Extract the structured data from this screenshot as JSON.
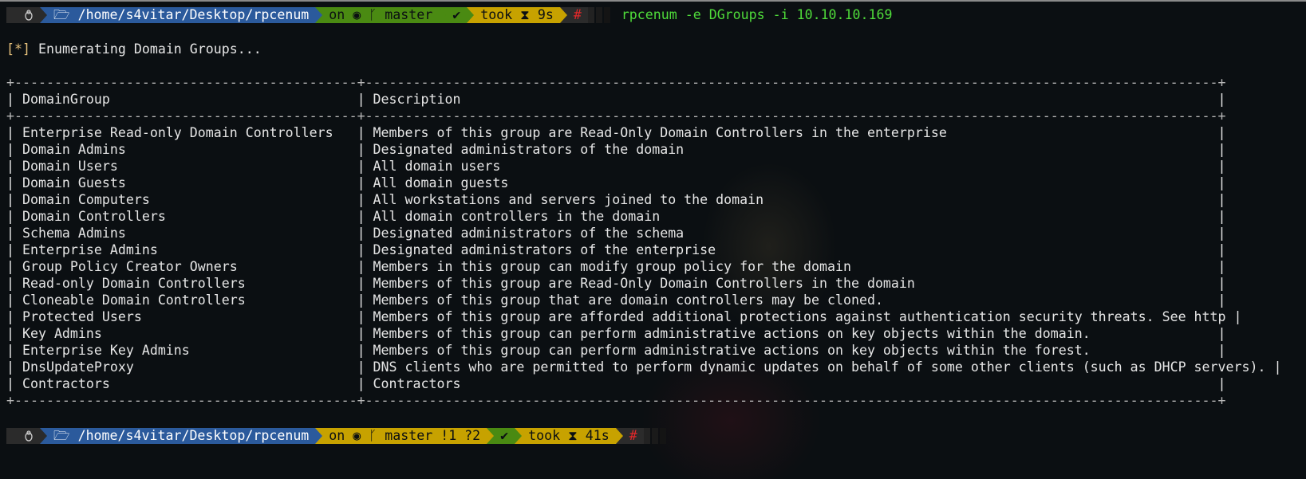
{
  "prompt1": {
    "os_icon": "linux-tux-icon",
    "folder_icon": "folder-icon",
    "path": "/home/s4vitar/Desktop/rpcenum",
    "git_on": "on",
    "git_icon": "github-octocat-icon",
    "branch_icon": "git-branch-icon",
    "branch": "master",
    "status_icon": "✔",
    "took": "took",
    "hourglass": "⧗",
    "duration": "9s",
    "hash": "#",
    "command": "rpcenum -e DGroups -i 10.10.10.169"
  },
  "output": {
    "message_prefix": "[*]",
    "message": " Enumerating Domain Groups..."
  },
  "table": {
    "border_top": "+-------------------------------------------+-----------------------------------------------------------------------------------------------------------+",
    "header_row": "| DomainGroup                               | Description                                                                                               |",
    "border_mid": "+-------------------------------------------+-----------------------------------------------------------------------------------------------------------+",
    "rows": [
      "| Enterprise Read-only Domain Controllers   | Members of this group are Read-Only Domain Controllers in the enterprise                                  |",
      "| Domain Admins                             | Designated administrators of the domain                                                                   |",
      "| Domain Users                              | All domain users                                                                                          |",
      "| Domain Guests                             | All domain guests                                                                                         |",
      "| Domain Computers                          | All workstations and servers joined to the domain                                                         |",
      "| Domain Controllers                        | All domain controllers in the domain                                                                      |",
      "| Schema Admins                             | Designated administrators of the schema                                                                   |",
      "| Enterprise Admins                         | Designated administrators of the enterprise                                                               |",
      "| Group Policy Creator Owners               | Members in this group can modify group policy for the domain                                              |",
      "| Read-only Domain Controllers              | Members of this group are Read-Only Domain Controllers in the domain                                      |",
      "| Cloneable Domain Controllers              | Members of this group that are domain controllers may be cloned.                                          |",
      "| Protected Users                           | Members of this group are afforded additional protections against authentication security threats. See http |",
      "| Key Admins                                | Members of this group can perform administrative actions on key objects within the domain.                |",
      "| Enterprise Key Admins                     | Members of this group can perform administrative actions on key objects within the forest.                |",
      "| DnsUpdateProxy                            | DNS clients who are permitted to perform dynamic updates on behalf of some other clients (such as DHCP servers). |",
      "| Contractors                               | Contractors                                                                                               |"
    ],
    "border_bottom": "+-------------------------------------------+-----------------------------------------------------------------------------------------------------------+"
  },
  "prompt2": {
    "path": "/home/s4vitar/Desktop/rpcenum",
    "git_on": "on",
    "branch": "master",
    "git_status": "!1 ?2",
    "status_icon": "✔",
    "took": "took",
    "hourglass": "⧗",
    "duration": "41s",
    "hash": "#"
  }
}
